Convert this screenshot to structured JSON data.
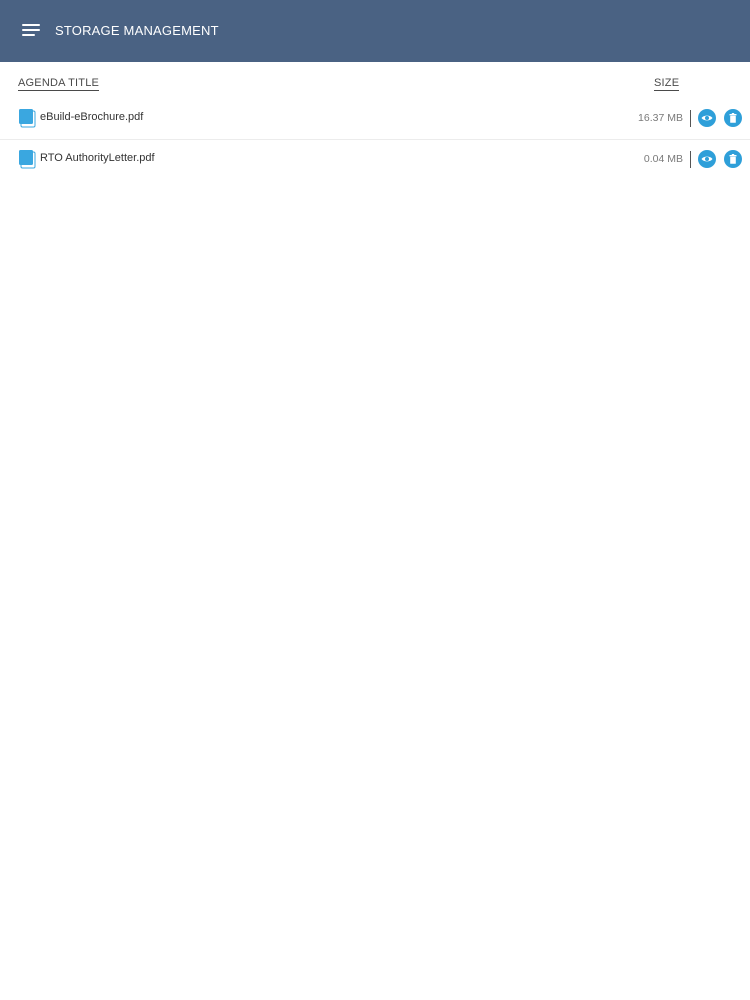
{
  "header": {
    "title": "STORAGE MANAGEMENT",
    "menu_icon": "hamburger-menu-icon",
    "background_color": "#4a6283"
  },
  "list_header": {
    "title_column": "AGENDA TITLE",
    "size_column": "SIZE"
  },
  "files": [
    {
      "icon": "document-icon",
      "name": "eBuild-eBrochure.pdf",
      "size": "16.37 MB",
      "actions": [
        "eye-icon",
        "trash-icon"
      ]
    },
    {
      "icon": "document-icon",
      "name": "RTO AuthorityLetter.pdf",
      "size": "0.04 MB",
      "actions": [
        "eye-icon",
        "trash-icon"
      ]
    }
  ],
  "colors": {
    "accent": "#2e9fd9",
    "file_icon": "#3aa7e0",
    "divider": "#ececec"
  }
}
